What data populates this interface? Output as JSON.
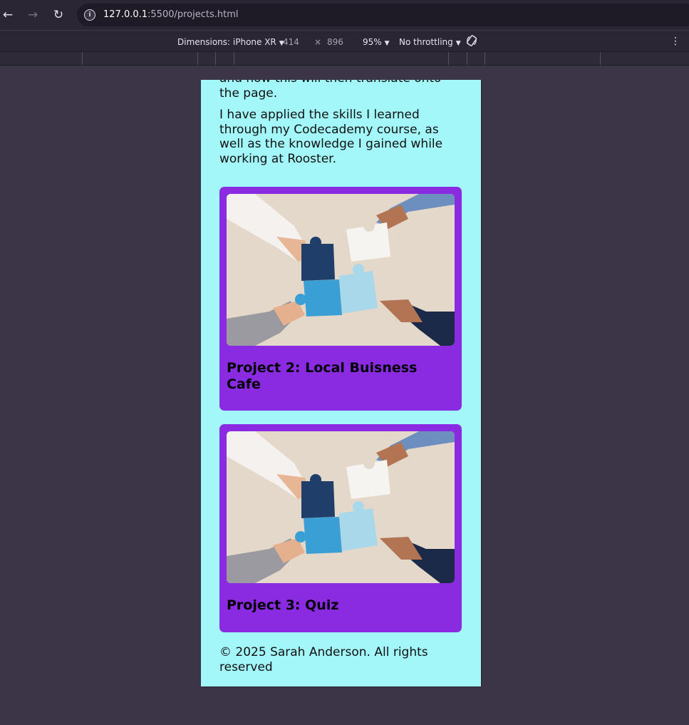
{
  "browser": {
    "nav": {
      "back_icon": "←",
      "forward_icon": "→",
      "reload_icon": "↻"
    },
    "url": {
      "host": "127.0.0.1",
      "path": ":5500/projects.html"
    }
  },
  "devtools": {
    "dimensions_label": "Dimensions: iPhone XR",
    "width": "414",
    "times": "×",
    "height": "896",
    "zoom": "95%",
    "throttling": "No throttling",
    "more_icon": "⋮"
  },
  "page": {
    "intro_tail": "and how this will then translate onto the page.",
    "skills_paragraph": "I have applied the skills I learned through my Codecademy course, as well as the knowledge I gained while working at Rooster.",
    "projects": [
      {
        "title": "Project 2: Local Buisness Cafe",
        "image": "puzzle-pieces-hands-photo"
      },
      {
        "title": "Project 3: Quiz",
        "image": "puzzle-pieces-hands-photo"
      }
    ],
    "footer": "© 2025 Sarah Anderson. All rights reserved"
  },
  "colors": {
    "page_background": "#a3f7f9",
    "card_background": "#8a2be2",
    "devtools_background": "#3c3547"
  }
}
